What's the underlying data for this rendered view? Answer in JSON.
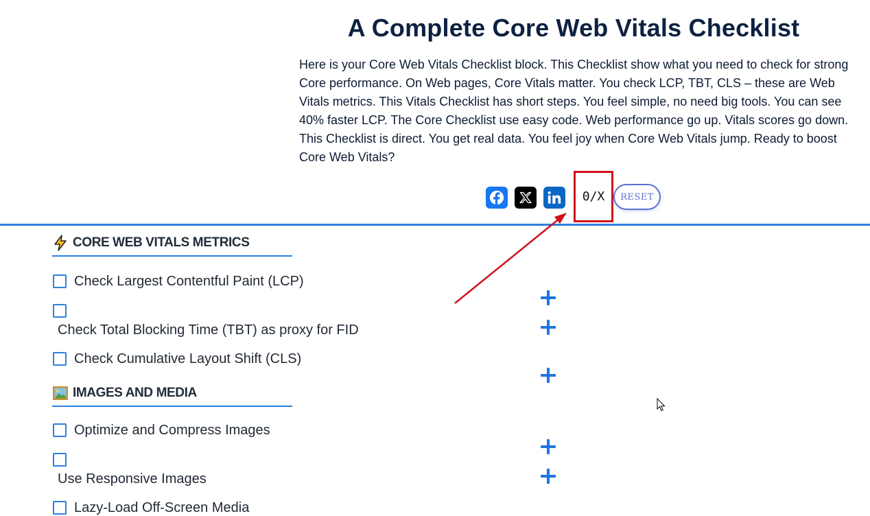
{
  "page": {
    "title": "A Complete Core Web Vitals Checklist",
    "intro": "Here is your Core Web Vitals Checklist block. This Checklist show what you need to check for strong Core performance. On Web pages, Core Vitals matter. You check LCP, TBT, CLS – these are Web Vitals metrics. This Vitals Checklist has short steps. You feel simple, no need big tools. You can see 40% faster LCP. The Core Checklist use easy code. Web performance go up. Vitals scores go down. This Checklist is direct. You get real data. You feel joy when Core Web Vitals jump. Ready to boost Core Web Vitals?"
  },
  "share": {
    "facebook_icon": "facebook-icon",
    "x_icon": "x-twitter-icon",
    "linkedin_icon": "linkedin-icon"
  },
  "progress": {
    "counter": "0/X",
    "reset_label": "RESET"
  },
  "colors": {
    "accent": "#2f7fe0",
    "title": "#0d2142",
    "highlight_box": "#d0101b",
    "arrow": "#d0101b"
  },
  "sections": [
    {
      "icon": "lightning-icon",
      "title": "CORE WEB VITALS METRICS",
      "items": [
        {
          "label": "Check Largest Contentful Paint (LCP)",
          "checked": false
        },
        {
          "label": "Check Total Blocking Time (TBT) as proxy for FID",
          "checked": false
        },
        {
          "label": "Check Cumulative Layout Shift (CLS)",
          "checked": false
        }
      ]
    },
    {
      "icon": "framed-picture-icon",
      "title": "IMAGES AND MEDIA",
      "items": [
        {
          "label": "Optimize and Compress Images",
          "checked": false
        },
        {
          "label": "Use Responsive Images",
          "checked": false
        },
        {
          "label": "Lazy-Load Off-Screen Media",
          "checked": false
        }
      ]
    }
  ]
}
